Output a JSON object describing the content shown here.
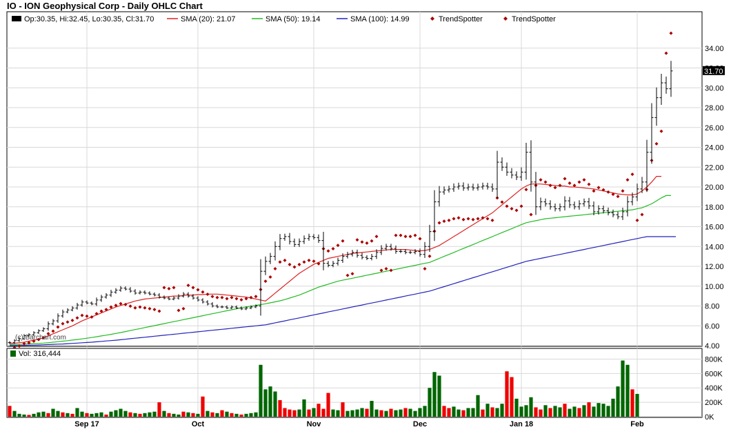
{
  "title": "IO - ION Geophysical Corp - Daily OHLC Chart",
  "watermark": "(c) Barchart.com",
  "colors": {
    "up_volume": "#006600",
    "down_volume": "#ee0000",
    "sma20": "#dd2222",
    "sma50": "#22bb22",
    "sma100": "#2222bb",
    "trendspotter": "#aa0000",
    "price_bars": "#000000"
  },
  "legend": {
    "ohlc": "Op:30.35, Hi:32.45, Lo:30.35, Cl:31.70",
    "sma20": "SMA (20): 21.07",
    "sma50": "SMA (50): 19.14",
    "sma100": "SMA (100): 14.99",
    "ts1": "TrendSpotter",
    "ts2": "TrendSpotter"
  },
  "volume_legend": "Vol: 316,444",
  "last_price_label": "31.70",
  "chart_data": [
    {
      "type": "ohlc",
      "title": "IO - ION Geophysical Corp - Daily OHLC Chart",
      "ylim": [
        4,
        36
      ],
      "y_ticks": [
        "4.00",
        "6.00",
        "8.00",
        "10.00",
        "12.00",
        "14.00",
        "16.00",
        "18.00",
        "20.00",
        "22.00",
        "24.00",
        "26.00",
        "28.00",
        "30.00",
        "32.00",
        "34.00"
      ],
      "x_ticks": [
        {
          "label": "Sep 17",
          "index": 16
        },
        {
          "label": "Oct",
          "index": 39
        },
        {
          "label": "Nov",
          "index": 63
        },
        {
          "label": "Dec",
          "index": 85
        },
        {
          "label": "Jan 18",
          "index": 106
        },
        {
          "label": "Feb",
          "index": 130
        }
      ],
      "grid": true,
      "closes": [
        4.3,
        4.5,
        4.7,
        5.0,
        5.1,
        5.3,
        5.5,
        5.7,
        6.2,
        6.5,
        7.0,
        7.4,
        7.6,
        7.8,
        8.1,
        8.4,
        8.3,
        8.2,
        8.6,
        8.9,
        9.1,
        9.4,
        9.6,
        9.8,
        9.7,
        9.5,
        9.3,
        9.4,
        9.3,
        9.2,
        9.1,
        8.9,
        8.8,
        8.7,
        8.8,
        9.0,
        9.2,
        9.0,
        8.8,
        8.6,
        8.4,
        8.2,
        8.0,
        7.9,
        7.9,
        7.8,
        7.9,
        7.8,
        7.7,
        7.8,
        7.9,
        8.0,
        11.5,
        12.5,
        13.0,
        14.0,
        14.8,
        15.0,
        14.5,
        14.2,
        14.5,
        14.8,
        15.0,
        14.9,
        14.6,
        12.3,
        12.1,
        12.3,
        12.6,
        13.0,
        13.2,
        13.4,
        13.1,
        12.9,
        12.8,
        13.0,
        13.4,
        13.8,
        14.0,
        13.8,
        13.5,
        13.5,
        13.4,
        13.4,
        13.5,
        13.2,
        14.0,
        15.5,
        18.5,
        19.5,
        19.7,
        19.8,
        20.0,
        20.1,
        19.9,
        20.0,
        19.9,
        20.0,
        20.1,
        20.0,
        19.8,
        22.5,
        22.0,
        21.5,
        21.2,
        21.0,
        21.5,
        23.5,
        20.5,
        18.0,
        18.5,
        18.3,
        18.0,
        17.8,
        18.0,
        18.6,
        18.2,
        18.0,
        18.3,
        18.5,
        18.1,
        17.5,
        17.8,
        17.6,
        17.4,
        17.2,
        17.0,
        17.5,
        18.5,
        19.0,
        19.8,
        20.5,
        23.5,
        27.0,
        29.0,
        30.5,
        29.9,
        31.7
      ],
      "series": [
        {
          "name": "SMA (20)",
          "values": [
            4.2,
            4.25,
            4.3,
            4.35,
            4.45,
            4.55,
            4.65,
            4.8,
            5.0,
            5.2,
            5.4,
            5.6,
            5.8,
            6.0,
            6.25,
            6.5,
            6.7,
            6.9,
            7.1,
            7.3,
            7.5,
            7.7,
            7.9,
            8.05,
            8.2,
            8.35,
            8.5,
            8.6,
            8.7,
            8.75,
            8.8,
            8.85,
            8.9,
            8.95,
            9.0,
            9.0,
            9.05,
            9.1,
            9.1,
            9.15,
            9.15,
            9.2,
            9.2,
            9.2,
            9.15,
            9.1,
            9.05,
            9.0,
            8.95,
            8.9,
            8.8,
            8.7,
            8.6,
            8.5,
            8.9,
            9.3,
            9.7,
            10.1,
            10.5,
            10.9,
            11.3,
            11.6,
            11.9,
            12.2,
            12.4,
            12.6,
            12.8,
            12.9,
            13.0,
            13.1,
            13.2,
            13.3,
            13.35,
            13.4,
            13.45,
            13.5,
            13.55,
            13.6,
            13.65,
            13.7,
            13.7,
            13.7,
            13.7,
            13.65,
            13.6,
            13.55,
            13.6,
            13.7,
            13.9,
            14.1,
            14.4,
            14.7,
            15.0,
            15.3,
            15.6,
            15.9,
            16.2,
            16.5,
            16.8,
            17.1,
            17.4,
            17.8,
            18.2,
            18.6,
            19.0,
            19.4,
            19.8,
            20.1,
            20.3,
            20.3,
            20.3,
            20.25,
            20.2,
            20.15,
            20.1,
            20.1,
            20.0,
            20.0,
            19.95,
            19.9,
            19.85,
            19.8,
            19.7,
            19.6,
            19.5,
            19.4,
            19.3,
            19.25,
            19.2,
            19.2,
            19.3,
            19.6,
            20.0,
            20.5,
            21.07,
            21.07
          ]
        },
        {
          "name": "SMA (50)",
          "values": [
            4.1,
            4.12,
            4.14,
            4.16,
            4.18,
            4.2,
            4.23,
            4.26,
            4.3,
            4.35,
            4.4,
            4.45,
            4.5,
            4.56,
            4.62,
            4.68,
            4.75,
            4.82,
            4.9,
            4.98,
            5.06,
            5.14,
            5.23,
            5.32,
            5.42,
            5.52,
            5.62,
            5.72,
            5.82,
            5.92,
            6.02,
            6.12,
            6.22,
            6.32,
            6.42,
            6.52,
            6.62,
            6.72,
            6.82,
            6.92,
            7.02,
            7.12,
            7.22,
            7.32,
            7.42,
            7.52,
            7.62,
            7.72,
            7.82,
            7.9,
            7.98,
            8.06,
            8.14,
            8.22,
            8.32,
            8.42,
            8.52,
            8.65,
            8.8,
            8.95,
            9.1,
            9.3,
            9.5,
            9.7,
            9.9,
            10.05,
            10.2,
            10.35,
            10.5,
            10.6,
            10.7,
            10.8,
            10.9,
            11.0,
            11.1,
            11.2,
            11.3,
            11.4,
            11.5,
            11.6,
            11.7,
            11.8,
            11.9,
            12.0,
            12.1,
            12.2,
            12.3,
            12.4,
            12.6,
            12.8,
            13.0,
            13.2,
            13.4,
            13.6,
            13.8,
            14.0,
            14.2,
            14.4,
            14.6,
            14.8,
            15.0,
            15.2,
            15.4,
            15.6,
            15.8,
            16.0,
            16.2,
            16.4,
            16.5,
            16.6,
            16.7,
            16.8,
            16.85,
            16.9,
            16.95,
            17.0,
            17.05,
            17.1,
            17.15,
            17.2,
            17.25,
            17.3,
            17.35,
            17.4,
            17.45,
            17.5,
            17.55,
            17.6,
            17.65,
            17.7,
            17.8,
            17.9,
            18.1,
            18.3,
            18.6,
            18.9,
            19.14,
            19.14
          ]
        },
        {
          "name": "SMA (100)",
          "values": [
            4.0,
            4.01,
            4.02,
            4.03,
            4.04,
            4.05,
            4.07,
            4.09,
            4.11,
            4.13,
            4.15,
            4.17,
            4.2,
            4.23,
            4.26,
            4.29,
            4.32,
            4.35,
            4.39,
            4.43,
            4.47,
            4.51,
            4.55,
            4.6,
            4.65,
            4.7,
            4.75,
            4.8,
            4.85,
            4.9,
            4.95,
            5.0,
            5.05,
            5.1,
            5.15,
            5.2,
            5.25,
            5.3,
            5.35,
            5.4,
            5.45,
            5.5,
            5.55,
            5.6,
            5.65,
            5.7,
            5.75,
            5.8,
            5.85,
            5.9,
            5.95,
            6.0,
            6.05,
            6.1,
            6.2,
            6.3,
            6.4,
            6.5,
            6.6,
            6.7,
            6.8,
            6.9,
            7.0,
            7.1,
            7.2,
            7.3,
            7.4,
            7.5,
            7.6,
            7.7,
            7.8,
            7.9,
            8.0,
            8.1,
            8.2,
            8.3,
            8.4,
            8.5,
            8.6,
            8.7,
            8.8,
            8.9,
            9.0,
            9.1,
            9.2,
            9.3,
            9.4,
            9.5,
            9.65,
            9.8,
            9.95,
            10.1,
            10.25,
            10.4,
            10.55,
            10.7,
            10.85,
            11.0,
            11.15,
            11.3,
            11.45,
            11.6,
            11.75,
            11.9,
            12.05,
            12.2,
            12.35,
            12.5,
            12.6,
            12.7,
            12.8,
            12.9,
            13.0,
            13.1,
            13.2,
            13.3,
            13.4,
            13.5,
            13.6,
            13.7,
            13.8,
            13.9,
            14.0,
            14.1,
            14.2,
            14.3,
            14.4,
            14.5,
            14.6,
            14.7,
            14.8,
            14.9,
            14.99,
            14.99,
            14.99,
            14.99,
            14.99,
            14.99,
            14.99
          ]
        }
      ]
    },
    {
      "type": "bar",
      "title": "Vol: 316,444",
      "ylim": [
        0,
        900000
      ],
      "y_ticks": [
        "0K",
        "200K",
        "400K",
        "600K",
        "800K"
      ],
      "values": [
        150000,
        80000,
        40000,
        30000,
        25000,
        40000,
        60000,
        70000,
        50000,
        110000,
        80000,
        60000,
        50000,
        40000,
        120000,
        70000,
        50000,
        40000,
        50000,
        60000,
        30000,
        70000,
        90000,
        110000,
        80000,
        60000,
        50000,
        40000,
        50000,
        60000,
        70000,
        200000,
        80000,
        50000,
        40000,
        30000,
        70000,
        60000,
        50000,
        40000,
        280000,
        80000,
        60000,
        50000,
        90000,
        70000,
        50000,
        40000,
        30000,
        40000,
        50000,
        60000,
        720000,
        380000,
        420000,
        350000,
        230000,
        120000,
        100000,
        90000,
        100000,
        240000,
        100000,
        120000,
        180000,
        110000,
        330000,
        100000,
        90000,
        200000,
        80000,
        90000,
        100000,
        120000,
        110000,
        220000,
        100000,
        90000,
        80000,
        110000,
        90000,
        100000,
        120000,
        110000,
        80000,
        120000,
        150000,
        400000,
        620000,
        570000,
        150000,
        120000,
        140000,
        100000,
        90000,
        120000,
        120000,
        300000,
        100000,
        180000,
        130000,
        120000,
        180000,
        630000,
        550000,
        250000,
        140000,
        160000,
        270000,
        130000,
        100000,
        160000,
        120000,
        150000,
        130000,
        180000,
        110000,
        140000,
        120000,
        160000,
        200000,
        140000,
        190000,
        180000,
        150000,
        250000,
        420000,
        780000,
        720000,
        380000,
        316444
      ],
      "up": [
        false,
        true,
        true,
        true,
        false,
        true,
        true,
        true,
        false,
        true,
        true,
        false,
        true,
        false,
        true,
        true,
        false,
        true,
        true,
        true,
        false,
        true,
        true,
        true,
        true,
        false,
        true,
        false,
        true,
        true,
        true,
        false,
        true,
        false,
        true,
        true,
        false,
        true,
        false,
        true,
        false,
        true,
        false,
        true,
        false,
        true,
        false,
        true,
        false,
        true,
        true,
        true,
        true,
        true,
        true,
        true,
        false,
        false,
        false,
        false,
        true,
        true,
        false,
        true,
        false,
        false,
        false,
        true,
        true,
        false,
        true,
        true,
        true,
        true,
        false,
        true,
        true,
        false,
        true,
        false,
        true,
        true,
        false,
        true,
        true,
        true,
        true,
        true,
        true,
        true,
        false,
        false,
        true,
        true,
        false,
        true,
        true,
        true,
        false,
        true,
        false,
        true,
        true,
        false,
        false,
        true,
        true,
        true,
        true,
        false,
        false,
        true,
        false,
        true,
        true,
        false,
        true,
        true,
        false,
        true,
        false,
        true,
        true,
        true,
        true,
        true,
        true,
        true,
        true,
        false,
        true
      ]
    }
  ]
}
